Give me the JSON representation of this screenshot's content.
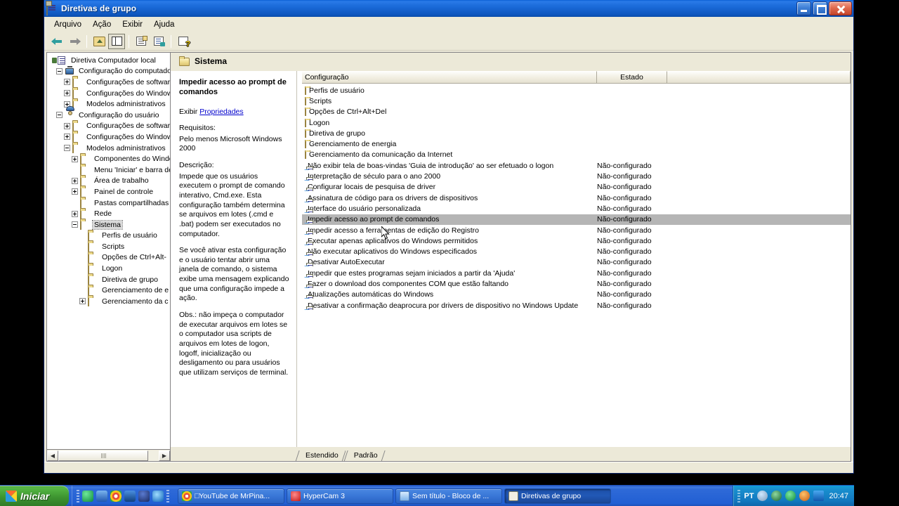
{
  "window": {
    "title": "Diretivas de grupo",
    "icon": "mmc-console-icon",
    "buttons": {
      "minimize": "Minimizar",
      "maximize": "Maximizar",
      "close": "Fechar"
    }
  },
  "menubar": {
    "items": [
      {
        "label": "Arquivo",
        "name": "menu-arquivo"
      },
      {
        "label": "Ação",
        "name": "menu-acao"
      },
      {
        "label": "Exibir",
        "name": "menu-exibir"
      },
      {
        "label": "Ajuda",
        "name": "menu-ajuda"
      }
    ]
  },
  "toolbar": {
    "buttons": [
      {
        "name": "back-arrow-icon",
        "tip": "Voltar"
      },
      {
        "name": "forward-arrow-icon",
        "tip": "Avançar"
      },
      {
        "name": "up-one-level-folder-icon",
        "tip": "Um nível acima"
      },
      {
        "name": "show-hide-console-tree-icon",
        "tip": "Mostrar/Ocultar árvore do console",
        "pressed": true
      },
      {
        "name": "properties-icon",
        "tip": "Propriedades"
      },
      {
        "name": "export-list-icon",
        "tip": "Exportar lista"
      },
      {
        "name": "help-icon",
        "tip": "Ajuda"
      }
    ]
  },
  "tree": {
    "items": [
      {
        "label": "Diretiva Computador local",
        "depth": 0,
        "icon": "policy-root-icon",
        "expander": "none"
      },
      {
        "label": "Configuração do computador",
        "depth": 1,
        "icon": "computer-icon",
        "expander": "minus"
      },
      {
        "label": "Configurações de software",
        "depth": 2,
        "icon": "folder-icon",
        "expander": "plus"
      },
      {
        "label": "Configurações do Windows",
        "depth": 2,
        "icon": "folder-icon",
        "expander": "plus"
      },
      {
        "label": "Modelos administrativos",
        "depth": 2,
        "icon": "folder-icon",
        "expander": "plus"
      },
      {
        "label": "Configuração do usuário",
        "depth": 1,
        "icon": "user-icon",
        "expander": "minus"
      },
      {
        "label": "Configurações de software",
        "depth": 2,
        "icon": "folder-icon",
        "expander": "plus"
      },
      {
        "label": "Configurações do Windows",
        "depth": 2,
        "icon": "folder-icon",
        "expander": "plus"
      },
      {
        "label": "Modelos administrativos",
        "depth": 2,
        "icon": "folder-icon",
        "expander": "minus"
      },
      {
        "label": "Componentes do Windo",
        "depth": 3,
        "icon": "folder-icon",
        "expander": "plus"
      },
      {
        "label": "Menu 'Iniciar' e barra de",
        "depth": 3,
        "icon": "folder-icon",
        "expander": "none"
      },
      {
        "label": "Área de trabalho",
        "depth": 3,
        "icon": "folder-icon",
        "expander": "plus"
      },
      {
        "label": "Painel de controle",
        "depth": 3,
        "icon": "folder-icon",
        "expander": "plus"
      },
      {
        "label": "Pastas compartilhadas",
        "depth": 3,
        "icon": "folder-icon",
        "expander": "none"
      },
      {
        "label": "Rede",
        "depth": 3,
        "icon": "folder-icon",
        "expander": "plus"
      },
      {
        "label": "Sistema",
        "depth": 3,
        "icon": "folder-open-icon",
        "expander": "minus",
        "selected": true
      },
      {
        "label": "Perfis de usuário",
        "depth": 4,
        "icon": "folder-icon",
        "expander": "none"
      },
      {
        "label": "Scripts",
        "depth": 4,
        "icon": "folder-icon",
        "expander": "none"
      },
      {
        "label": "Opções de Ctrl+Alt-",
        "depth": 4,
        "icon": "folder-icon",
        "expander": "none"
      },
      {
        "label": "Logon",
        "depth": 4,
        "icon": "folder-icon",
        "expander": "none"
      },
      {
        "label": "Diretiva de grupo",
        "depth": 4,
        "icon": "folder-icon",
        "expander": "none"
      },
      {
        "label": "Gerenciamento de e",
        "depth": 4,
        "icon": "folder-icon",
        "expander": "none"
      },
      {
        "label": "Gerenciamento da c",
        "depth": 4,
        "icon": "folder-icon",
        "expander": "plus"
      }
    ],
    "hscroll": {
      "left_arrow": "◀",
      "right_arrow": "▶"
    }
  },
  "pane": {
    "header_title": "Sistema",
    "header_icon": "folder-icon"
  },
  "description": {
    "title": "Impedir acesso ao prompt de comandos",
    "show_label": "Exibir",
    "link_label": "Propriedades",
    "requirements_label": "Requisitos:",
    "requirements_value": "Pelo menos Microsoft Windows 2000",
    "description_label": "Descrição:",
    "paragraph1": "Impede que os usuários executem o prompt de comando interativo, Cmd.exe. Esta configuração também determina se arquivos em lotes (.cmd e .bat) podem ser executados no computador.",
    "paragraph2": "Se você ativar esta configuração e o usuário tentar abrir uma janela de comando, o sistema exibe uma mensagem explicando que uma configuração impede a ação.",
    "paragraph3": "Obs.: não impeça o computador de executar arquivos em lotes se o computador usa scripts de arquivos em lotes de logon, logoff, inicialização ou desligamento ou para usuários que utilizam serviços de terminal."
  },
  "list": {
    "columns": [
      "Configuração",
      "Estado",
      ""
    ],
    "rows": [
      {
        "name": "Perfis de usuário",
        "state": "",
        "icon": "folder-icon"
      },
      {
        "name": "Scripts",
        "state": "",
        "icon": "folder-icon"
      },
      {
        "name": "Opções de Ctrl+Alt+Del",
        "state": "",
        "icon": "folder-icon"
      },
      {
        "name": "Logon",
        "state": "",
        "icon": "folder-icon"
      },
      {
        "name": "Diretiva de grupo",
        "state": "",
        "icon": "folder-icon"
      },
      {
        "name": "Gerenciamento de energia",
        "state": "",
        "icon": "folder-icon"
      },
      {
        "name": "Gerenciamento da comunicação da Internet",
        "state": "",
        "icon": "folder-icon"
      },
      {
        "name": "Não exibir tela de boas-vindas 'Guia de introdução' ao ser efetuado o logon",
        "state": "Não-configurado",
        "icon": "policy-setting-icon"
      },
      {
        "name": "Interpretação de século para o ano 2000",
        "state": "Não-configurado",
        "icon": "policy-setting-icon"
      },
      {
        "name": "Configurar locais de pesquisa de driver",
        "state": "Não-configurado",
        "icon": "policy-setting-icon"
      },
      {
        "name": "Assinatura de código para os drivers de dispositivos",
        "state": "Não-configurado",
        "icon": "policy-setting-icon"
      },
      {
        "name": "Interface do usuário personalizada",
        "state": "Não-configurado",
        "icon": "policy-setting-icon"
      },
      {
        "name": "Impedir acesso ao prompt de comandos",
        "state": "Não-configurado",
        "icon": "policy-setting-icon",
        "selected": true
      },
      {
        "name": "Impedir acesso a ferramentas de edição do Registro",
        "state": "Não-configurado",
        "icon": "policy-setting-icon"
      },
      {
        "name": "Executar apenas aplicativos do Windows permitidos",
        "state": "Não-configurado",
        "icon": "policy-setting-icon"
      },
      {
        "name": "Não executar aplicativos do Windows especificados",
        "state": "Não-configurado",
        "icon": "policy-setting-icon"
      },
      {
        "name": "Desativar AutoExecutar",
        "state": "Não-configurado",
        "icon": "policy-setting-icon"
      },
      {
        "name": "Impedir que estes programas sejam iniciados a partir da 'Ajuda'",
        "state": "Não-configurado",
        "icon": "policy-setting-icon"
      },
      {
        "name": "Fazer o download dos componentes COM que estão faltando",
        "state": "Não-configurado",
        "icon": "policy-setting-icon"
      },
      {
        "name": "Atualizações automáticas do Windows",
        "state": "Não-configurado",
        "icon": "policy-setting-icon"
      },
      {
        "name": "Desativar a confirmação deaprocura por drivers de dispositivo no Windows Update",
        "state": "Não-configurado",
        "icon": "policy-setting-icon"
      }
    ]
  },
  "tabs": [
    {
      "label": "Estendido",
      "active": true
    },
    {
      "label": "Padrão",
      "active": false
    }
  ],
  "taskbar": {
    "start_label": "Iniciar",
    "quicklaunch": [
      {
        "name": "ql-messenger-icon",
        "color": "#12a44a"
      },
      {
        "name": "ql-gif-icon",
        "color": "#2a6ad0"
      },
      {
        "name": "ql-chrome-icon",
        "color": "#e8a020"
      },
      {
        "name": "ql-media-icon",
        "color": "#1f6fbf"
      },
      {
        "name": "ql-bug-icon",
        "color": "#2a4a8a"
      },
      {
        "name": "ql-internet-explorer-icon",
        "color": "#1a7fd4"
      }
    ],
    "tasks": [
      {
        "label": "□YouTube de MrPina...",
        "icon": "chrome-icon",
        "active": false
      },
      {
        "label": "HyperCam 3",
        "icon": "hypercam-icon",
        "active": false
      },
      {
        "label": "Sem título - Bloco de ...",
        "icon": "notepad-icon",
        "active": false
      },
      {
        "label": "Diretivas de grupo",
        "icon": "mmc-console-icon",
        "active": true
      }
    ],
    "tray": {
      "language": "PT",
      "icons": [
        "show-hidden-icons-chevron",
        "antivirus-icon",
        "messenger-icon",
        "updates-icon",
        "media-player-icon"
      ],
      "clock": "20:47"
    }
  },
  "colors": {
    "titlebar_blue": "#0a5fd4",
    "taskbar_blue": "#215fd3",
    "start_green": "#3d9430",
    "window_face": "#ece9d8",
    "selection_gray": "#b5b5b5",
    "link_blue": "#0000cc"
  }
}
